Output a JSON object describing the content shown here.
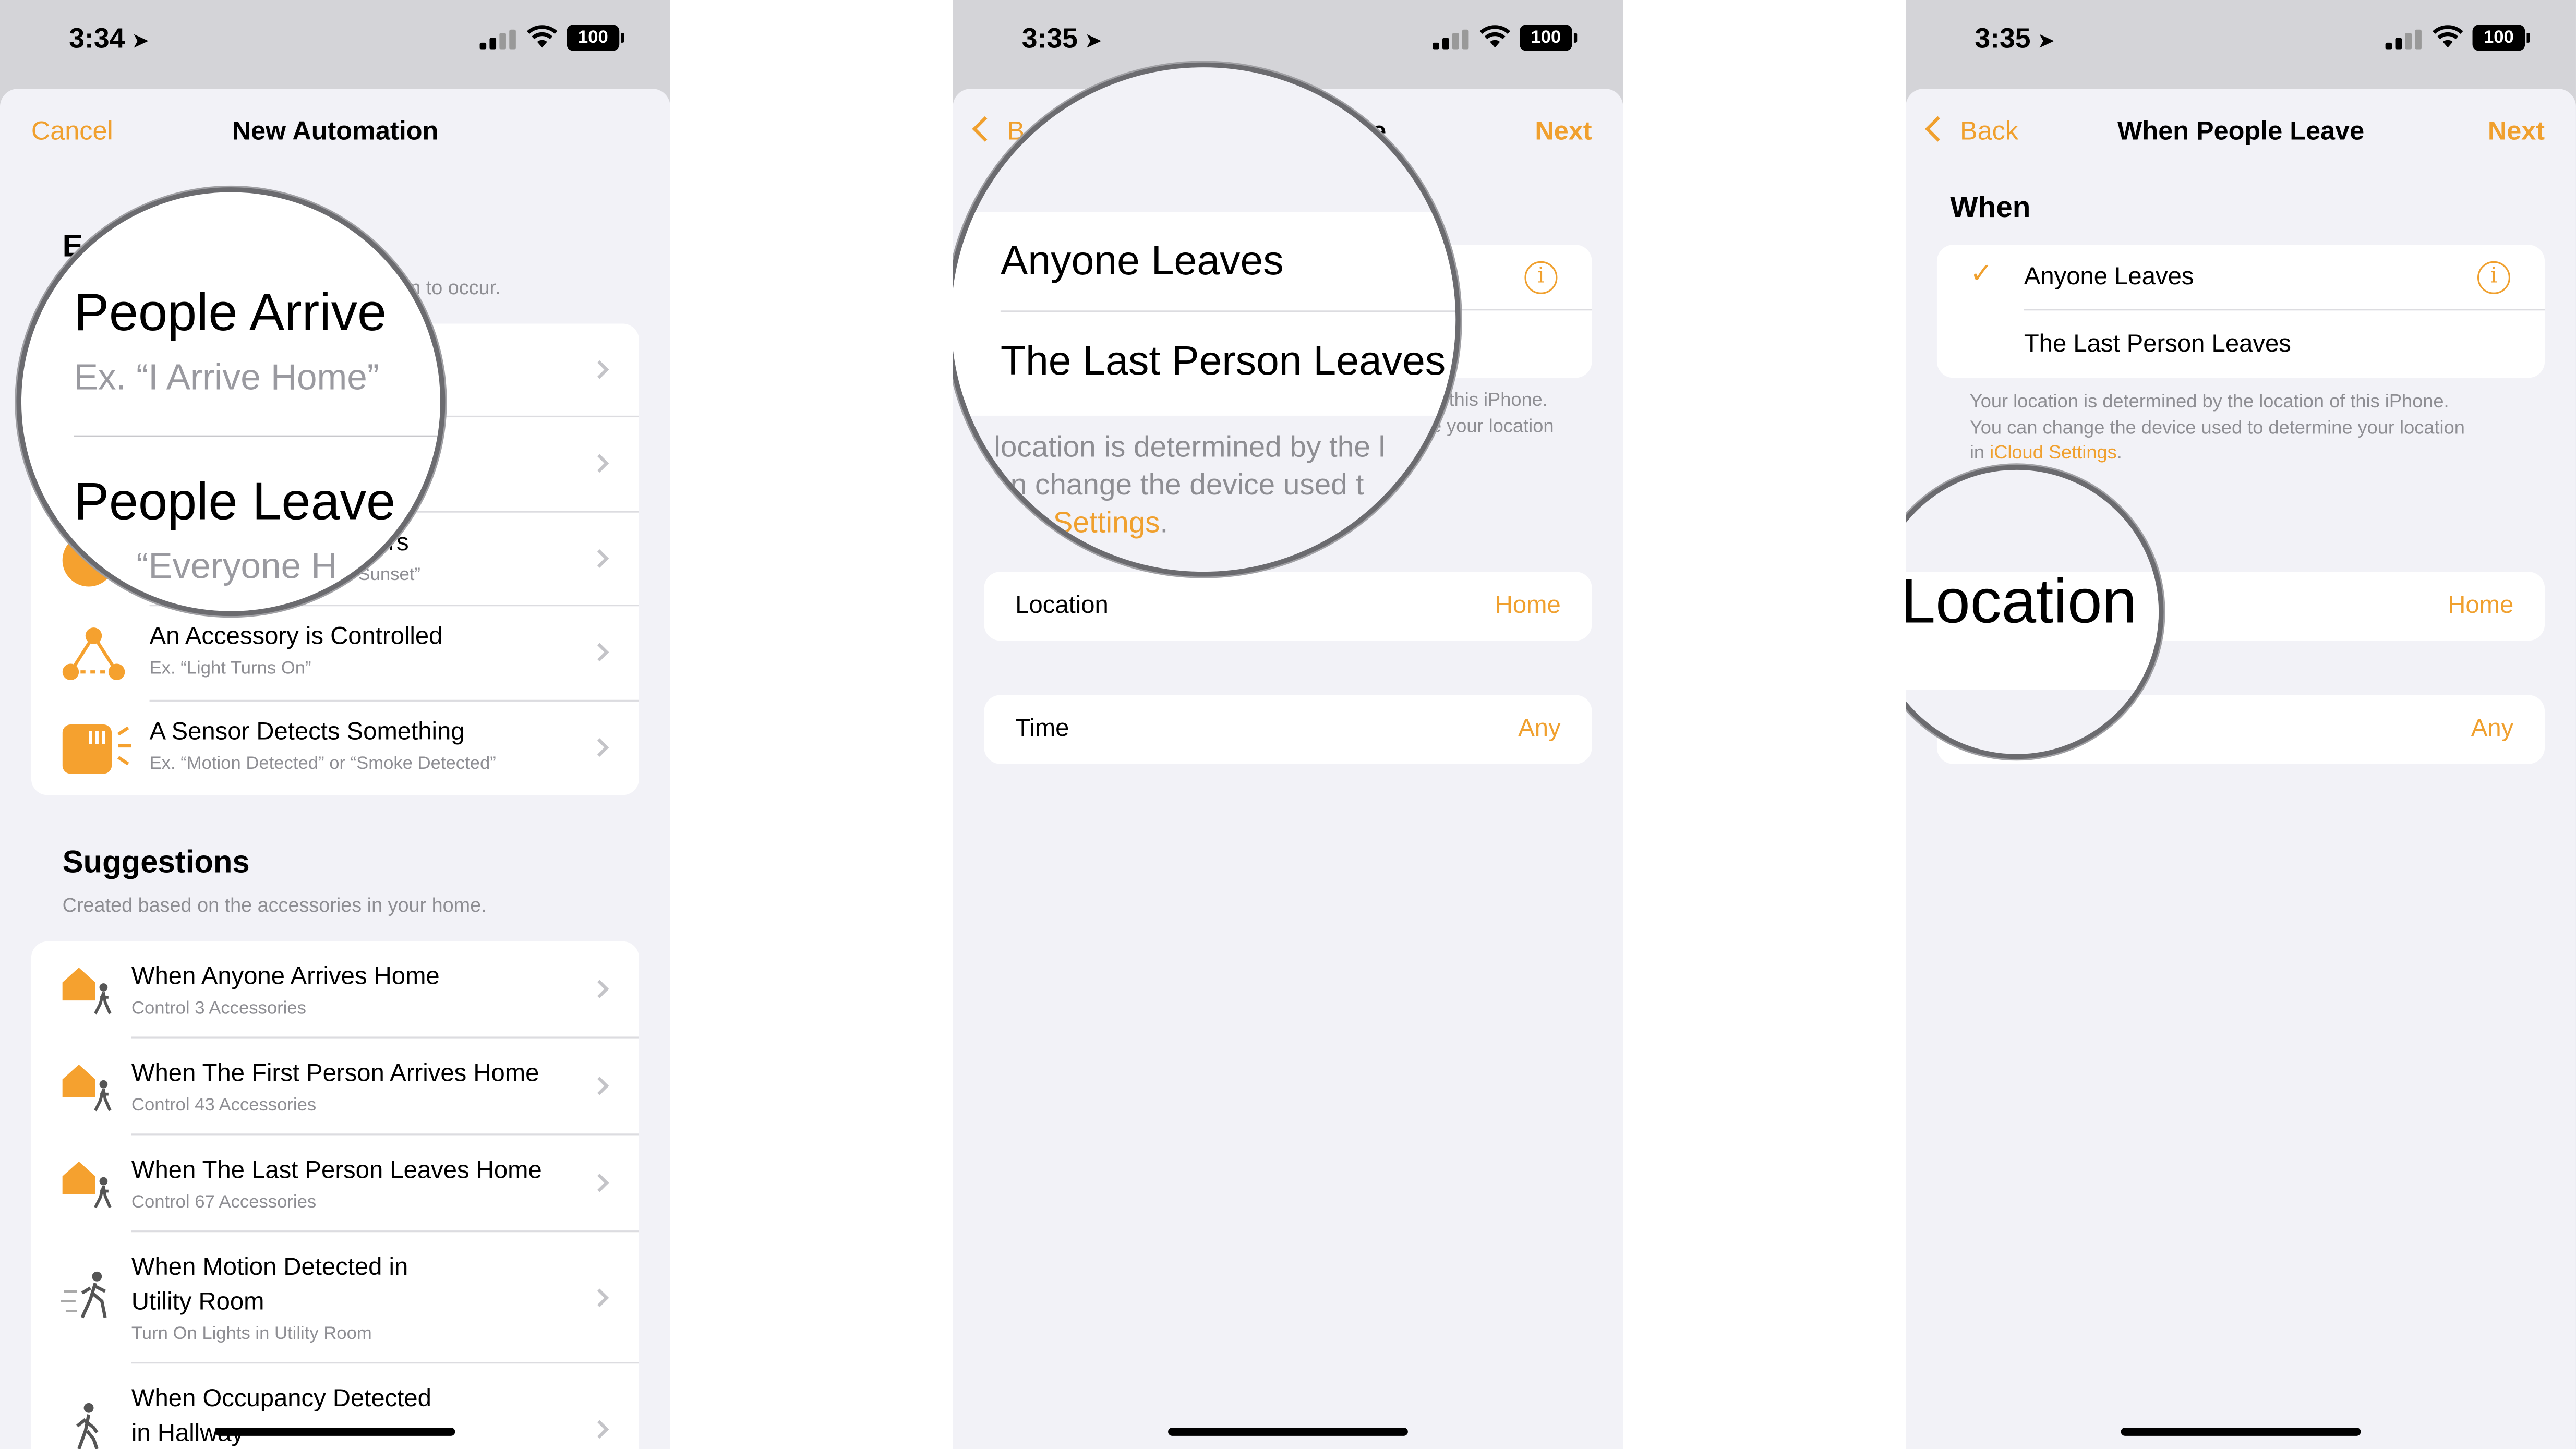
{
  "status_bars": [
    {
      "time": "3:34",
      "battery": "100"
    },
    {
      "time": "3:35",
      "battery": "100"
    },
    {
      "time": "3:35",
      "battery": "100"
    }
  ],
  "screen1": {
    "nav": {
      "cancel": "Cancel",
      "title": "New Automation"
    },
    "events_footer_partial": "ion to occur.",
    "events_head_partial": "E",
    "events": [
      {
        "title": "",
        "subtitle": "",
        "icon": "location-icon"
      },
      {
        "title": "",
        "subtitle": "",
        "icon": "location-icon"
      },
      {
        "title": "urs",
        "subtitle": "Sunset”",
        "icon": "clock-icon"
      },
      {
        "title": "An Accessory is Controlled",
        "subtitle": "Ex. “Light Turns On”",
        "icon": "accessory-icon"
      },
      {
        "title": "A Sensor Detects Something",
        "subtitle": "Ex. “Motion Detected” or “Smoke Detected”",
        "icon": "sensor-icon"
      }
    ],
    "suggestions_head": "Suggestions",
    "suggestions_foot": "Created based on the accessories in your home.",
    "suggestions": [
      {
        "title": "When Anyone Arrives Home",
        "subtitle": "Control 3 Accessories",
        "icon": "home-person-icon"
      },
      {
        "title": "When The First Person Arrives Home",
        "subtitle": "Control 43 Accessories",
        "icon": "home-person-icon"
      },
      {
        "title": "When The Last Person Leaves Home",
        "subtitle": "Control 67 Accessories",
        "icon": "home-person-icon"
      },
      {
        "title_line1": "When Motion Detected in",
        "title_line2": "Utility Room",
        "subtitle": "Turn On Lights in Utility Room",
        "icon": "motion-icon"
      },
      {
        "title_line1": "When Occupancy Detected",
        "title_line2": "in Hallway",
        "subtitle": "",
        "icon": "occupancy-icon"
      }
    ],
    "magnifier": {
      "title1": "People Arrive",
      "sub1": "Ex. “I Arrive Home”",
      "title2": "People Leave",
      "sub2": "“Everyone H"
    }
  },
  "screen2": {
    "nav": {
      "back_partial": "B",
      "title_partial": "ve",
      "next": "Next"
    },
    "foot_partial_1": "this iPhone.",
    "foot_partial_2": "e your location",
    "location_label": "Location",
    "location_value": "Home",
    "time_label": "Time",
    "time_value": "Any",
    "magnifier": {
      "opt1": "Anyone Leaves",
      "opt2": "The Last Person Leaves",
      "foot1": "location is determined by the l",
      "foot2": "n change the device used t",
      "foot3_link": "Settings",
      "foot3_dot": "."
    }
  },
  "screen3": {
    "nav": {
      "back": "Back",
      "title": "When People Leave",
      "next": "Next"
    },
    "when_head": "When",
    "options": [
      {
        "label": "Anyone Leaves",
        "checked": true
      },
      {
        "label": "The Last Person Leaves",
        "checked": false
      }
    ],
    "foot_line1": "Your location is determined by the location of this iPhone.",
    "foot_line2": "You can change the device used to determine your location",
    "foot_line3_prefix": "in ",
    "foot_link": "iCloud Settings",
    "foot_dot": ".",
    "location_value": "Home",
    "time_value": "Any",
    "magnifier": {
      "label": "Location"
    }
  },
  "colors": {
    "accent": "#f0a02e",
    "group_bg": "#ffffff",
    "sheet_bg": "#f2f2f7",
    "secondary_text": "#8e8e93"
  }
}
